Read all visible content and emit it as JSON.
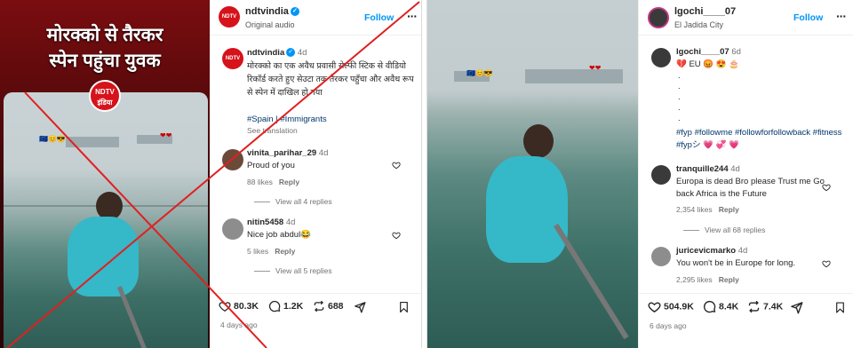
{
  "left": {
    "reel_title_line1": "मोरक्को से तैरकर",
    "reel_title_line2": "स्पेन पहुंचा युवक",
    "badge": "NDTV इंडिया",
    "header": {
      "username": "ndtvindia",
      "subtitle": "Original audio",
      "follow_label": "Follow"
    },
    "caption": {
      "username": "ndtvindia",
      "age": "4d",
      "text": "मोरक्को का एक अवैध प्रवासी सेल्फी स्टिक से वीडियो रिकॉर्ड करते हुए सेउटा तक तैरकर पहुँचा और अवैध रूप से स्पेन में दाखिल हो गया",
      "tags": "#Spain | #Immigrants",
      "see_translation": "See translation"
    },
    "comments": [
      {
        "username": "vinita_parihar_29",
        "age": "4d",
        "text": "Proud of you",
        "likes": "88 likes",
        "reply": "Reply",
        "view_replies": "View all 4 replies"
      },
      {
        "username": "nitin5458",
        "age": "4d",
        "text": "Nice job abdul😂",
        "likes": "5 likes",
        "reply": "Reply",
        "view_replies": "View all 5 replies"
      }
    ],
    "stats": {
      "likes": "80.3K",
      "comments": "1.2K",
      "shares": "688"
    },
    "time_ago": "4 days ago"
  },
  "right": {
    "header": {
      "username": "lgochi____07",
      "subtitle": "El Jadida City",
      "follow_label": "Follow"
    },
    "caption": {
      "username": "lgochi____07",
      "age": "6d",
      "text": "💔 EU 😡 😍 🎂",
      "dots": ". . . . .",
      "tags": "#fyp #followme #followforfollowback #fitness #fypシ 💗 💞 💗"
    },
    "comments": [
      {
        "username": "tranquille244",
        "age": "4d",
        "text": "Europa is dead Bro please Trust me Go back Africa is the Future",
        "likes": "2,354 likes",
        "reply": "Reply",
        "view_replies": "View all 68 replies"
      },
      {
        "username": "juricevicmarko",
        "age": "4d",
        "text": "You won't be in Europe for long.",
        "likes": "2,295 likes",
        "reply": "Reply"
      }
    ],
    "stats": {
      "likes": "504.9K",
      "comments": "8.4K",
      "shares": "7.4K"
    },
    "time_ago": "6 days ago"
  },
  "colors": {
    "accent": "#0095f6",
    "cross": "#e02020",
    "brand_red": "#d6121b"
  }
}
